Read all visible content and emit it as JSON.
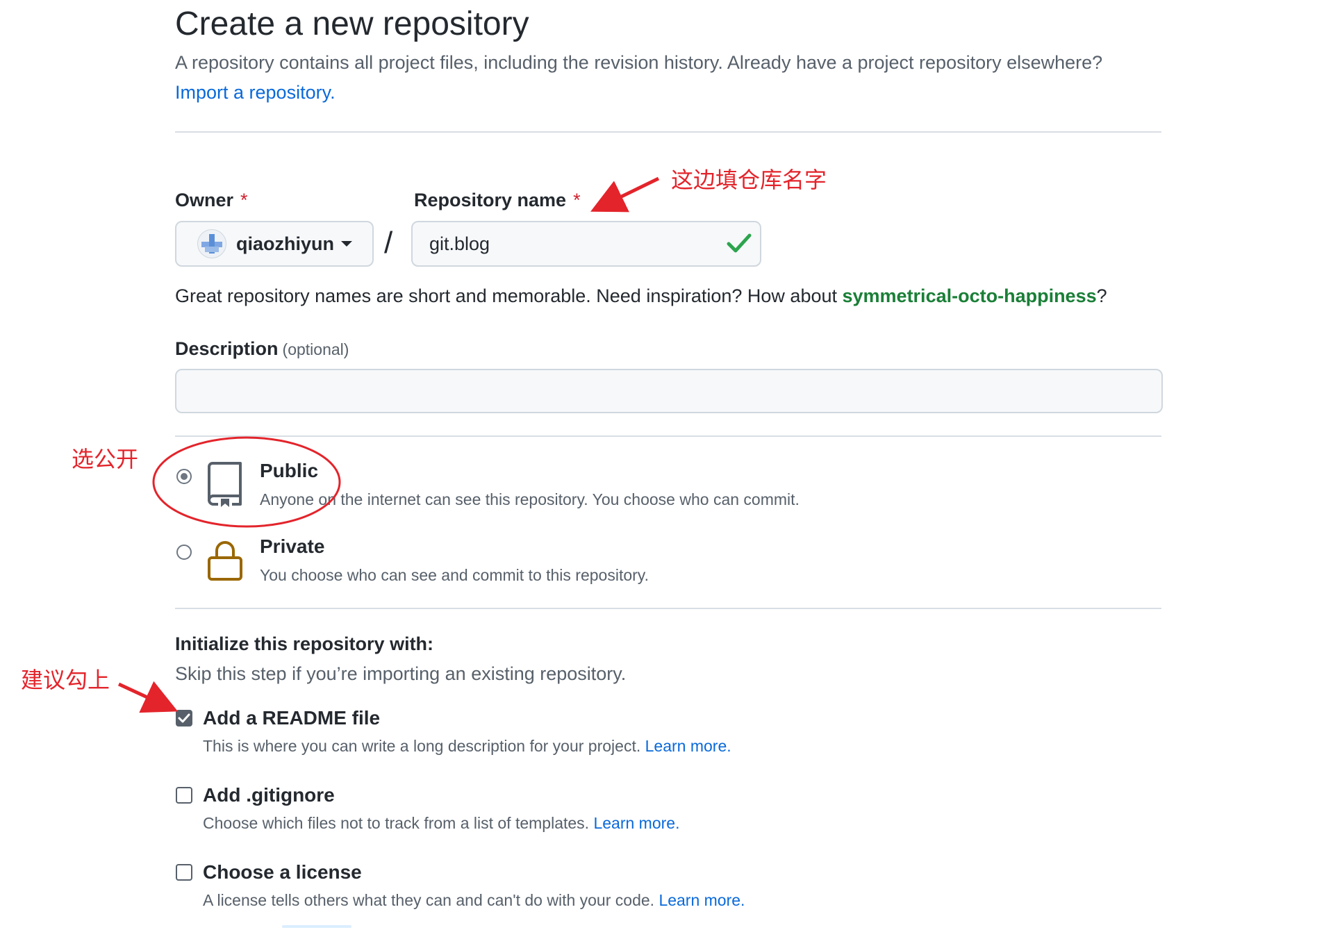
{
  "header": {
    "title": "Create a new repository",
    "intro": "A repository contains all project files, including the revision history. Already have a project repository elsewhere?",
    "import_link": "Import a repository."
  },
  "owner": {
    "label": "Owner",
    "required_mark": "*",
    "selected": "qiaozhiyun",
    "avatar_icon": "identicon-avatar",
    "caret_icon": "caret-down-icon"
  },
  "separator": "/",
  "repo_name": {
    "label": "Repository name",
    "required_mark": "*",
    "value": "git.blog",
    "status_icon": "check-icon",
    "status_color": "#2da44e"
  },
  "hint": {
    "text_before": "Great repository names are short and memorable. Need inspiration? How about ",
    "suggestion": "symmetrical-octo-happiness",
    "text_after": "?"
  },
  "description": {
    "label": "Description",
    "optional": "(optional)",
    "value": ""
  },
  "visibility": {
    "selected": "public",
    "public": {
      "title": "Public",
      "desc": "Anyone on the internet can see this repository. You choose who can commit.",
      "icon": "repo-icon"
    },
    "private": {
      "title": "Private",
      "desc": "You choose who can see and commit to this repository.",
      "icon": "lock-icon"
    }
  },
  "init": {
    "title": "Initialize this repository with:",
    "subtitle": "Skip this step if you’re importing an existing repository.",
    "options": [
      {
        "title": "Add a README file",
        "desc": "This is where you can write a long description for your project.",
        "link": "Learn more.",
        "checked": true
      },
      {
        "title": "Add .gitignore",
        "desc": "Choose which files not to track from a list of templates.",
        "link": "Learn more.",
        "checked": false
      },
      {
        "title": "Choose a license",
        "desc": "A license tells others what they can and can't do with your code.",
        "link": "Learn more.",
        "checked": false
      }
    ]
  },
  "annotations": {
    "repo_name_note": "这边填仓库名字",
    "public_note": "选公开",
    "readme_note": "建议勾上",
    "color": "#e3242b"
  },
  "colors": {
    "link": "#0969da",
    "suggestion": "#1a7f37",
    "required": "#cf222e",
    "lock": "#9a6700"
  }
}
